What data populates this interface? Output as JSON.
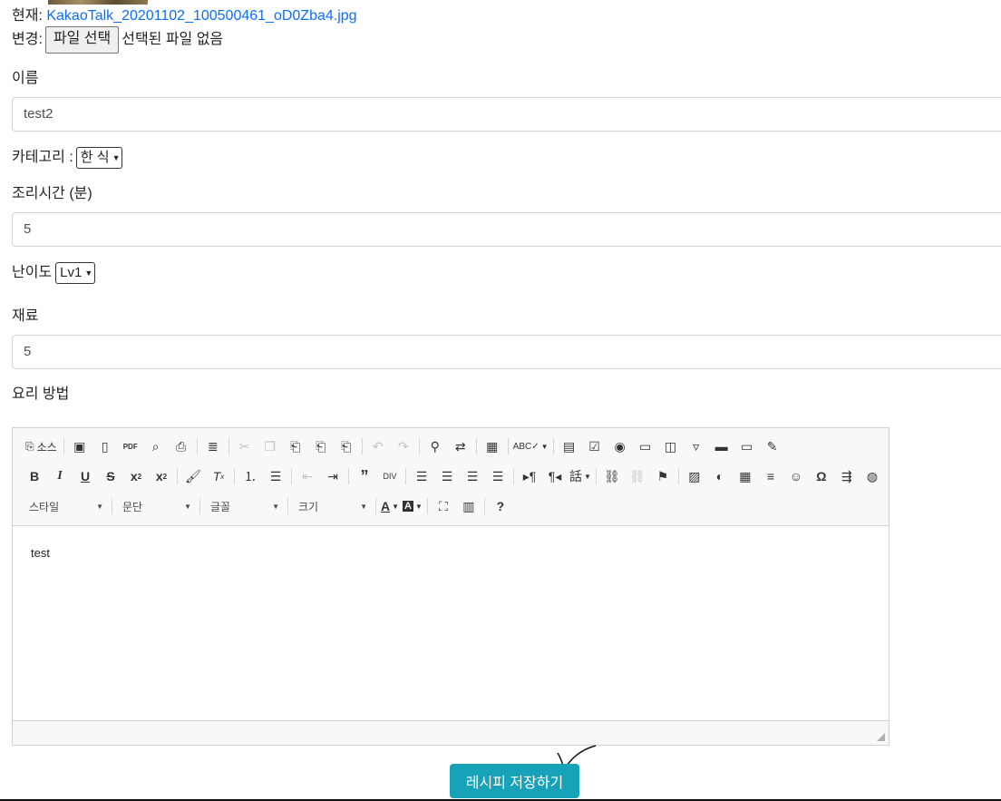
{
  "file": {
    "current_label": "현재:",
    "current_filename": "KakaoTalk_20201102_100500461_oD0Zba4.jpg",
    "change_label": "변경:",
    "choose_button": "파일 선택",
    "no_file_text": "선택된 파일 없음"
  },
  "form": {
    "name_label": "이름",
    "name_value": "test2",
    "category_label": "카테고리 :",
    "category_value": "한 식",
    "time_label": "조리시간 (분)",
    "time_value": "5",
    "difficulty_label": "난이도",
    "difficulty_value": "Lv1",
    "ingredients_label": "재료",
    "ingredients_value": "5",
    "method_label": "요리 방법"
  },
  "editor": {
    "source_label": "소스",
    "style_combo": "스타일",
    "format_combo": "문단",
    "font_combo": "글꼴",
    "size_combo": "크기",
    "content": "test"
  },
  "submit": {
    "label": "레시피 저장하기"
  }
}
